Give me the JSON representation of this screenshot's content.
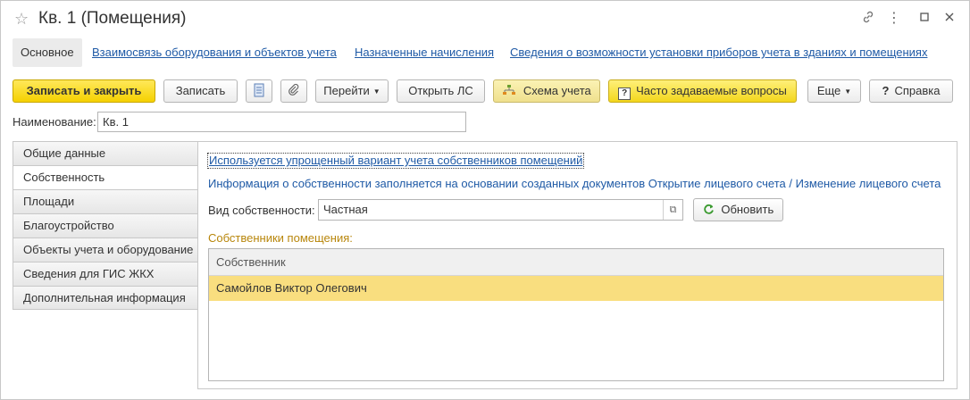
{
  "window": {
    "title": "Кв. 1 (Помещения)"
  },
  "nav": {
    "items": [
      {
        "label": "Основное",
        "active": true
      },
      {
        "label": "Взаимосвязь оборудования и объектов учета",
        "active": false
      },
      {
        "label": "Назначенные начисления",
        "active": false
      },
      {
        "label": "Сведения о возможности установки приборов учета в зданиях и помещениях",
        "active": false
      }
    ]
  },
  "toolbar": {
    "save_close": "Записать и закрыть",
    "save": "Записать",
    "go": "Перейти",
    "open_ls": "Открыть ЛС",
    "scheme": "Схема учета",
    "faq": "Часто задаваемые вопросы",
    "more": "Еще",
    "help": "Справка",
    "help_mark": "?",
    "faq_mark": "?"
  },
  "name": {
    "label": "Наименование:",
    "value": "Кв. 1"
  },
  "tabs": [
    {
      "label": "Общие данные",
      "active": false
    },
    {
      "label": "Собственность",
      "active": true
    },
    {
      "label": "Площади",
      "active": false
    },
    {
      "label": "Благоустройство",
      "active": false
    },
    {
      "label": "Объекты учета и оборудование",
      "active": false
    },
    {
      "label": "Сведения для ГИС ЖКХ",
      "active": false
    },
    {
      "label": "Дополнительная информация",
      "active": false
    }
  ],
  "ownership": {
    "simplified_link": "Используется упрощенный вариант учета собственников помещений",
    "info_text": "Информация о собственности заполняется на основании созданных документов Открытие лицевого счета / Изменение лицевого счета",
    "type_label": "Вид собственности:",
    "type_value": "Частная",
    "refresh_label": "Обновить",
    "owners_label": "Собственники помещения:",
    "table_header": "Собственник",
    "owners": [
      "Самойлов Виктор Олегович"
    ]
  },
  "colors": {
    "accent_yellow": "#f5d100",
    "link_blue": "#1f5aa6",
    "selected_row": "#f9de7f",
    "section_label": "#b8860b"
  }
}
